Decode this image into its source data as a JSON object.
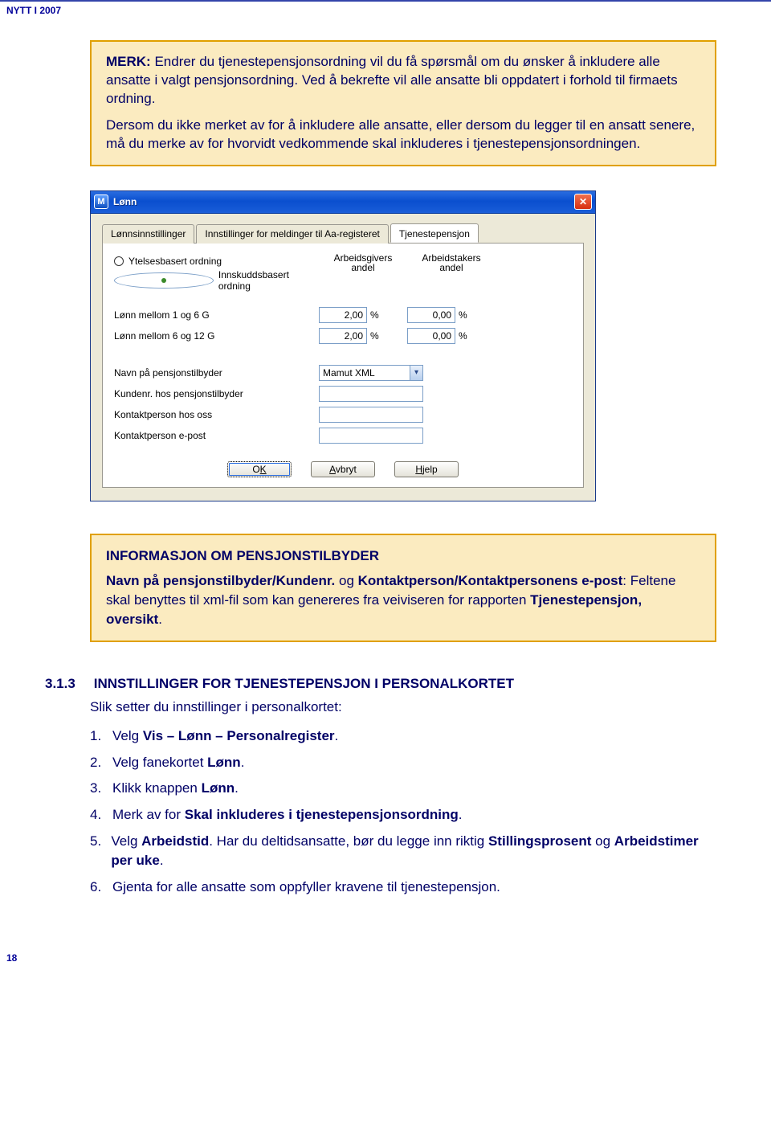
{
  "header": {
    "label": "NYTT I 2007"
  },
  "note": {
    "p1_bold": "MERK:",
    "p1": " Endrer du tjenestepensjonsordning vil du få spørsmål om du ønsker å inkludere alle ansatte i valgt pensjonsordning. Ved å bekrefte vil alle ansatte bli oppdatert i forhold til firmaets ordning.",
    "p2": "Dersom du ikke merket av for å inkludere alle ansatte, eller dersom du legger til en ansatt senere, må du merke av for hvorvidt vedkommende skal inkluderes i tjenestepensjonsordningen."
  },
  "win": {
    "title": "Lønn",
    "tabs": [
      "Lønnsinnstillinger",
      "Innstillinger for meldinger til Aa-registeret",
      "Tjenestepensjon"
    ],
    "radio1": "Ytelsesbasert ordning",
    "radio2": "Innskuddsbasert ordning",
    "col1a": "Arbeidsgivers",
    "col1b": "andel",
    "col2a": "Arbeidstakers",
    "col2b": "andel",
    "row1_lbl": "Lønn mellom 1 og 6 G",
    "row1_v1": "2,00",
    "row1_v2": "0,00",
    "row2_lbl": "Lønn mellom 6 og 12 G",
    "row2_v1": "2,00",
    "row2_v2": "0,00",
    "pct": "%",
    "lbl_navn": "Navn på pensjonstilbyder",
    "val_navn": "Mamut XML",
    "lbl_kund": "Kundenr. hos pensjonstilbyder",
    "lbl_kont": "Kontaktperson hos oss",
    "lbl_epost": "Kontaktperson e-post",
    "btn_ok_pre": "O",
    "btn_ok_u": "K",
    "btn_av_pre": "",
    "btn_av_u": "A",
    "btn_av_post": "vbryt",
    "btn_hj_pre": "",
    "btn_hj_u": "H",
    "btn_hj_post": "jelp"
  },
  "info": {
    "title": "INFORMASJON OM PENSJONSTILBYDER",
    "b1": "Navn på pensjonstilbyder/Kundenr.",
    "mid": " og ",
    "b2": "Kontaktperson/Kontaktpersonens e-post",
    "tail": ": Feltene skal benyttes til xml-fil som kan genereres fra veiviseren for rapporten ",
    "b3": "Tjenestepensjon, oversikt",
    "dot": "."
  },
  "section": {
    "num": "3.1.3",
    "title": "INNSTILLINGER FOR TJENESTEPENSJON I PERSONALKORTET",
    "intro": "Slik setter du innstillinger i personalkortet:",
    "items": [
      {
        "n": "1.",
        "pre": "Velg ",
        "b": "Vis – Lønn – Personalregister",
        "post": "."
      },
      {
        "n": "2.",
        "pre": "Velg fanekortet ",
        "b": "Lønn",
        "post": "."
      },
      {
        "n": "3.",
        "pre": "Klikk knappen ",
        "b": "Lønn",
        "post": "."
      },
      {
        "n": "4.",
        "pre": "Merk av for ",
        "b": "Skal inkluderes i tjenestepensjonsordning",
        "post": "."
      },
      {
        "n": "5.",
        "pre": "Velg ",
        "b": "Arbeidstid",
        "post": ". Har du deltidsansatte, bør du legge inn riktig ",
        "b2": "Stillingsprosent",
        "post2": " og ",
        "b3": "Arbeidstimer per uke",
        "post3": "."
      },
      {
        "n": "6.",
        "pre": "Gjenta for alle ansatte som oppfyller kravene til tjenestepensjon.",
        "b": "",
        "post": ""
      }
    ]
  },
  "footer": {
    "page": "18"
  }
}
